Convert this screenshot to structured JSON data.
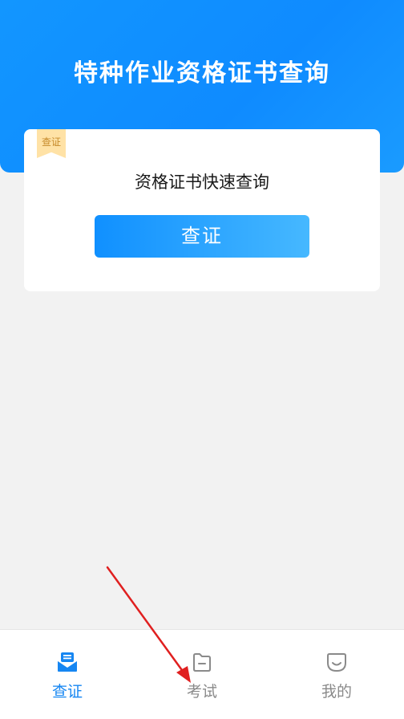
{
  "header": {
    "title": "特种作业资格证书查询"
  },
  "card": {
    "badge": "查证",
    "subtitle": "资格证书快速查询",
    "button_label": "查证"
  },
  "tabbar": {
    "items": [
      {
        "label": "查证",
        "icon": "mailbox-icon",
        "active": true
      },
      {
        "label": "考试",
        "icon": "folder-icon",
        "active": false
      },
      {
        "label": "我的",
        "icon": "smile-face-icon",
        "active": false
      }
    ]
  },
  "colors": {
    "primary": "#1296ff",
    "button_gradient_start": "#1090ff",
    "button_gradient_end": "#46b8ff",
    "badge_bg": "#ffe2a6",
    "active_tab": "#1686f2",
    "inactive_tab": "#8a8a8a",
    "annotation_arrow": "#e02020"
  }
}
